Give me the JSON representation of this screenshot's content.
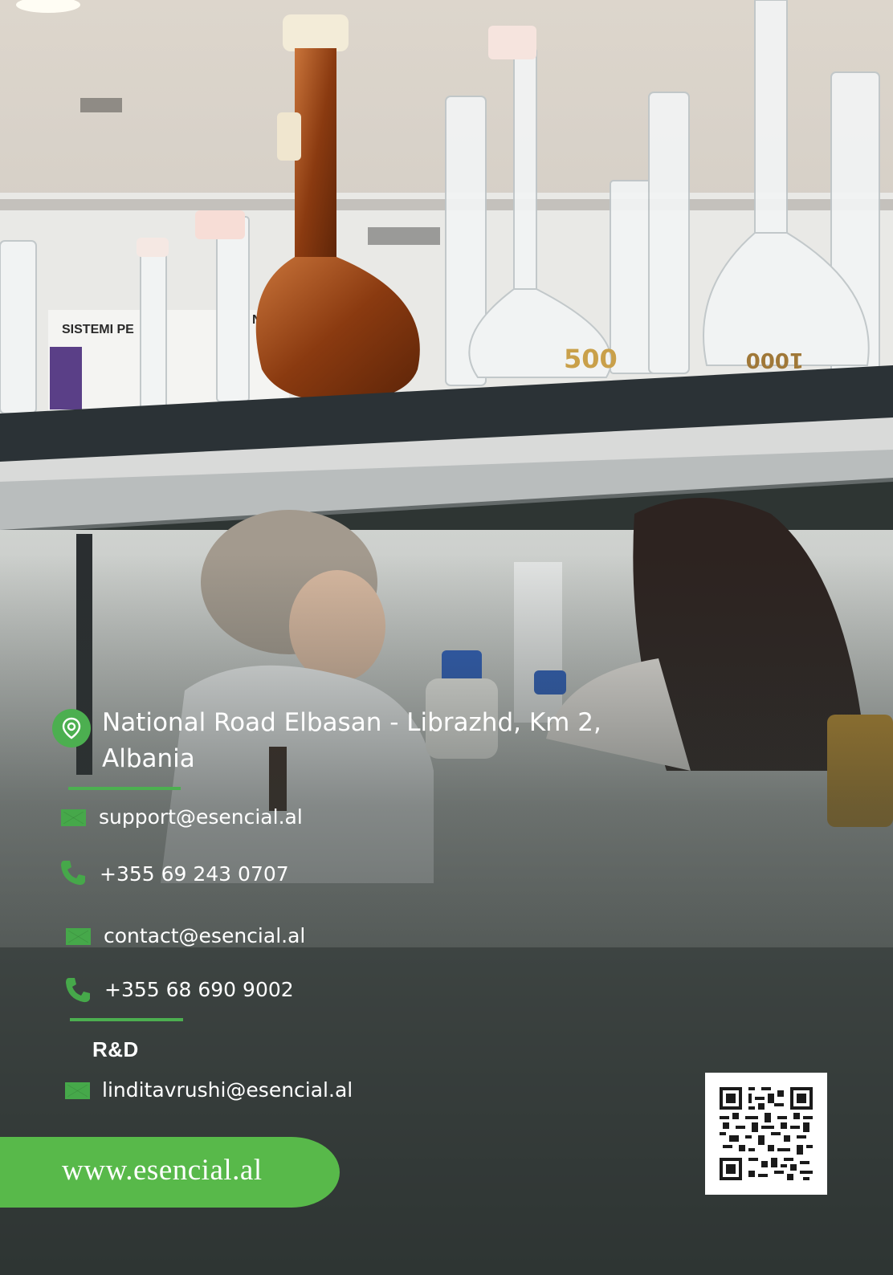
{
  "photo": {
    "wall_sign_text": "SISTEMI PE",
    "wall_sign_text_2": "NTE",
    "flask_label_1": "500",
    "flask_label_2": "1000"
  },
  "contact": {
    "address_line1": "National Road Elbasan - Librazhd, Km 2,",
    "address_line2": "Albania",
    "email_support": "support@esencial.al",
    "phone_1": "+355 69 243 0707",
    "email_contact": "contact@esencial.al",
    "phone_2": "+355 68 690 9002",
    "rd_label": "R&D",
    "email_rd": "linditavrushi@esencial.al"
  },
  "website": "www.esencial.al",
  "colors": {
    "accent": "#4caf50",
    "background": "#2e3533"
  },
  "icons": [
    "location-pin-icon",
    "mail-icon",
    "phone-icon",
    "qr-code"
  ]
}
